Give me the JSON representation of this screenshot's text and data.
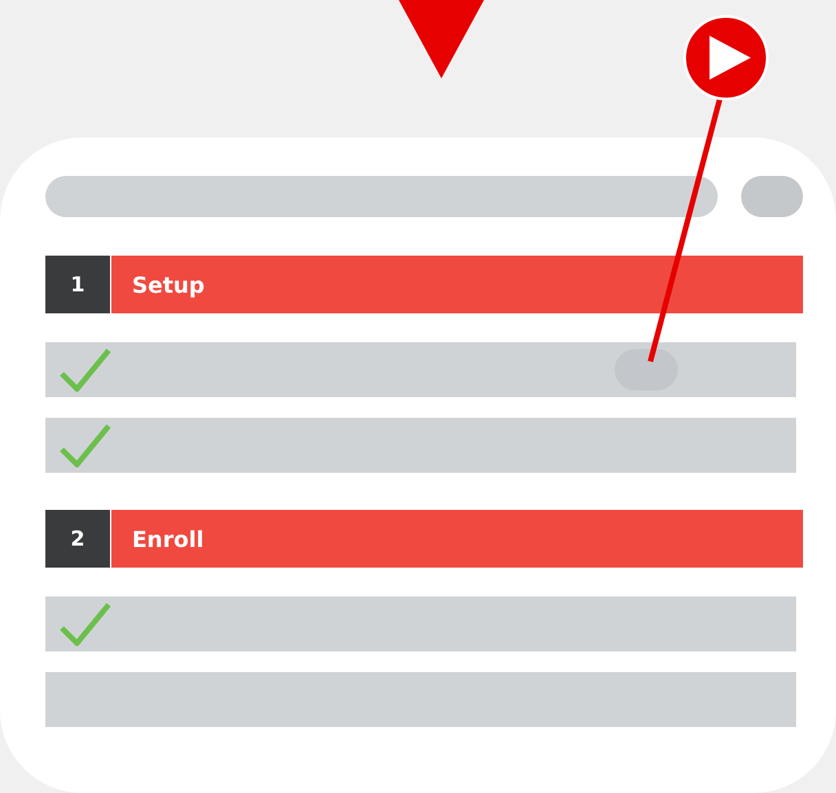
{
  "sections": [
    {
      "number": "1",
      "title": "Setup",
      "items": [
        {
          "kind": "pill",
          "checked": true
        },
        {
          "kind": "plain",
          "checked": true
        }
      ]
    },
    {
      "number": "2",
      "title": "Enroll",
      "items": [
        {
          "kind": "plain",
          "checked": true
        },
        {
          "kind": "plain",
          "checked": false
        }
      ]
    }
  ]
}
